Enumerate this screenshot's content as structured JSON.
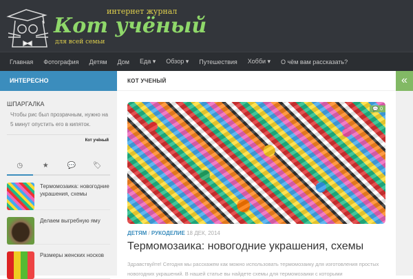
{
  "header": {
    "tagline_top": "интернет журнал",
    "title": "Кот учёный",
    "tagline_bottom": "для всей семьи"
  },
  "nav": [
    "Главная",
    "Фотография",
    "Детям",
    "Дом",
    "Еда ▾",
    "Обзор ▾",
    "Путешествия",
    "Хобби ▾",
    "О чём вам рассказать?"
  ],
  "left": {
    "heading": "ИНТЕРЕСНО",
    "widget_title": "ШПАРГАЛКА",
    "widget_text": "Чтобы рис был прозрачным, нужно на 5 минут опустить его в кипяток.",
    "widget_author": "Кот учёный",
    "tabs": [
      "◷",
      "★",
      "💬",
      "🏷"
    ],
    "posts": [
      "Термомозаика: новогодние украшения, схемы",
      "Делаем выгребную яму",
      "Размеры женских носков"
    ]
  },
  "main": {
    "heading": "КОТ УЧЕНЫЙ",
    "comments": "0",
    "category1": "ДЕТЯМ",
    "sep": " / ",
    "category2": "РУКОДЕЛИЕ",
    "date": "18 ДЕК, 2014",
    "title": "Термомозаика: новогодние украшения, схемы",
    "excerpt": "Здравствуйте! Сегодня мы расскажем как можно использовать термомозаику для изготовления простых новогодних украшений. В нашей статье вы найдете схемы для термомозаики с которыми"
  },
  "right": {
    "toggle": "«"
  },
  "colors": {
    "header": "#33363b",
    "accent": "#3b8dbd",
    "green": "#82b965"
  }
}
